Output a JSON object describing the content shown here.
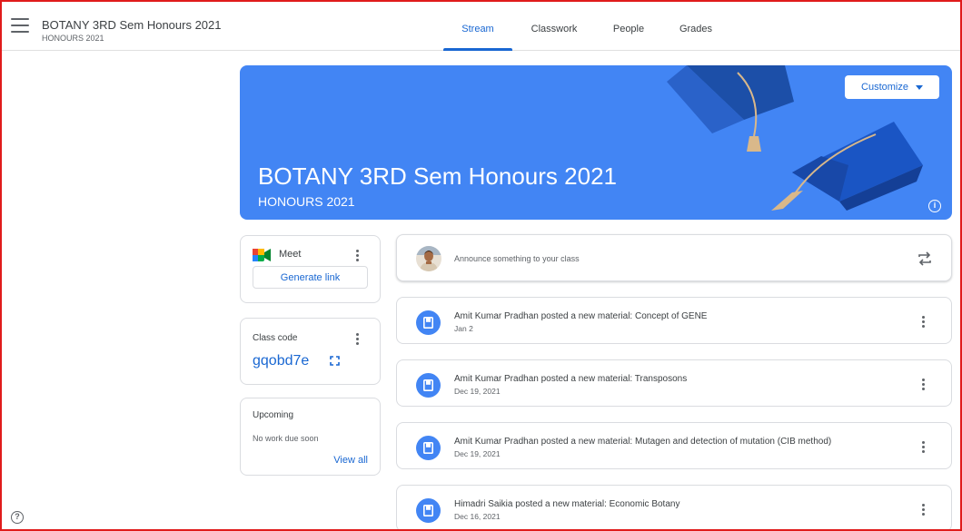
{
  "header": {
    "class_name": "BOTANY 3RD Sem Honours 2021",
    "section": "HONOURS 2021",
    "tabs": [
      {
        "label": "Stream",
        "active": true
      },
      {
        "label": "Classwork",
        "active": false
      },
      {
        "label": "People",
        "active": false
      },
      {
        "label": "Grades",
        "active": false
      }
    ]
  },
  "banner": {
    "title": "BOTANY 3RD Sem Honours 2021",
    "subtitle": "HONOURS 2021",
    "customize_label": "Customize",
    "color": "#4285f4"
  },
  "meet": {
    "label": "Meet",
    "generate_label": "Generate link"
  },
  "class_code": {
    "label": "Class code",
    "value": "gqobd7e"
  },
  "upcoming": {
    "label": "Upcoming",
    "empty_text": "No work due soon",
    "view_all": "View all"
  },
  "announce": {
    "placeholder": "Announce something to your class"
  },
  "posts": [
    {
      "text": "Amit Kumar Pradhan posted a new material: Concept of GENE",
      "date": "Jan 2"
    },
    {
      "text": "Amit Kumar Pradhan posted a new material: Transposons",
      "date": "Dec 19, 2021"
    },
    {
      "text": "Amit Kumar Pradhan posted a new material: Mutagen and detection of mutation (CIB method)",
      "date": "Dec 19, 2021"
    },
    {
      "text": "Himadri Saikia posted a new material: Economic Botany",
      "date": "Dec 16, 2021"
    }
  ],
  "colors": {
    "accent": "#1967d2",
    "frame": "#e01b1b"
  }
}
